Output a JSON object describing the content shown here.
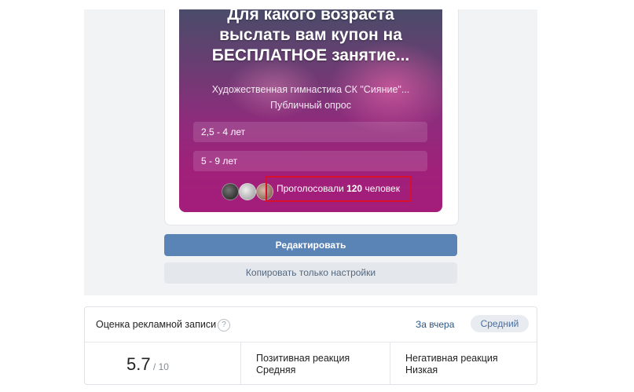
{
  "poll": {
    "title_lines": [
      "Для какого возраста",
      "выслать вам купон на",
      "БЕСПЛАТНОЕ занятие..."
    ],
    "author": "Художественная гимнастика СК \"Сияние\"...",
    "type": "Публичный опрос",
    "options": [
      {
        "label": "2,5 - 4 лет"
      },
      {
        "label": "5 - 9 лет"
      }
    ],
    "voted_prefix": "Проголосовали ",
    "voted_count": "120",
    "voted_suffix": " человек"
  },
  "actions": {
    "edit_label": "Редактировать",
    "copy_label": "Копировать только настройки"
  },
  "rating": {
    "title": "Оценка рекламной записи",
    "help_icon": "?",
    "period_link": "За вчера",
    "period_chip": "Средний",
    "score": "5.7",
    "score_max": " / 10",
    "positive_label": "Позитивная реакция",
    "positive_value": "Средняя",
    "negative_label": "Негативная реакция",
    "negative_value": "Низкая"
  },
  "colors": {
    "primary_button": "#5b84b6",
    "highlight_box": "#d8102a",
    "poll_gradient_end": "#a41d7a"
  }
}
